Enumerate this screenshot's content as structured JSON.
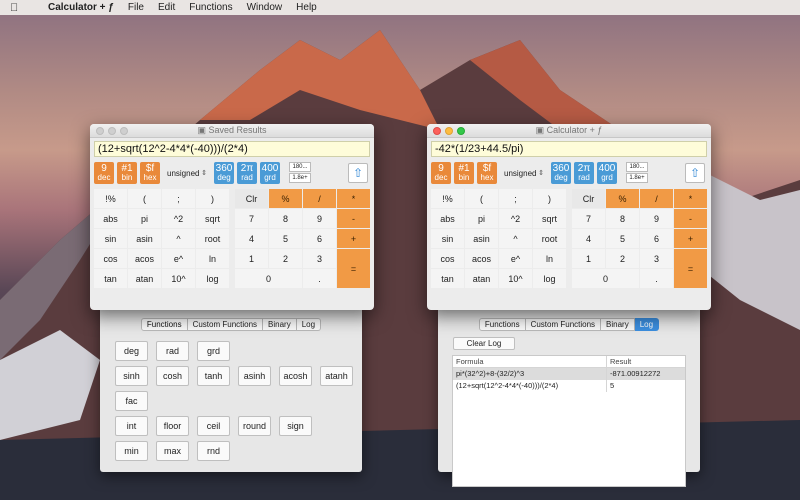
{
  "menubar": {
    "app": "Calculator + ƒ",
    "items": [
      "File",
      "Edit",
      "Functions",
      "Window",
      "Help"
    ]
  },
  "left": {
    "title": "Saved Results",
    "expression": "(12+sqrt(12^2-4*4*(-40)))/(2*4)"
  },
  "right": {
    "title": "Calculator + ƒ",
    "expression": "-42*(1/23+44.5/pi)"
  },
  "modes": {
    "base": [
      {
        "top": "9",
        "sub": "dec"
      },
      {
        "top": "#1",
        "sub": "bin"
      },
      {
        "top": "$f",
        "sub": "hex"
      }
    ],
    "signed": "unsigned",
    "angle": [
      {
        "top": "360",
        "sub": "deg"
      },
      {
        "top": "2π",
        "sub": "rad"
      },
      {
        "top": "400",
        "sub": "grd"
      }
    ],
    "sci": [
      "180...",
      "1.8e+"
    ]
  },
  "keys": {
    "func": [
      "!%",
      "(",
      ";",
      ")",
      "abs",
      "pi",
      "^2",
      "sqrt",
      "sin",
      "asin",
      "^",
      "root",
      "cos",
      "acos",
      "e^",
      "ln",
      "tan",
      "atan",
      "10^",
      "log"
    ],
    "clr": "Clr",
    "pct": "%",
    "div": "/",
    "mul": "*",
    "sub": "-",
    "add": "+",
    "eq": "=",
    "digits": [
      "7",
      "8",
      "9",
      "4",
      "5",
      "6",
      "1",
      "2",
      "3"
    ],
    "zero": "0",
    "dot": "."
  },
  "lpanel": {
    "tabs": [
      "Functions",
      "Custom Functions",
      "Binary",
      "Log"
    ],
    "rows": [
      [
        "deg",
        "rad",
        "grd"
      ],
      [
        "sinh",
        "cosh",
        "tanh",
        "asinh",
        "acosh",
        "atanh"
      ],
      [
        "fac"
      ],
      [
        "int",
        "floor",
        "ceil",
        "round",
        "sign"
      ],
      [
        "min",
        "max",
        "rnd"
      ]
    ]
  },
  "rpanel": {
    "tabs": [
      "Functions",
      "Custom Functions",
      "Binary",
      "Log"
    ],
    "clear": "Clear Log",
    "cols": [
      "Formula",
      "Result"
    ],
    "rows": [
      {
        "f": "pi*(32^2)+8-(32/2)^3",
        "r": "-871.00912272"
      },
      {
        "f": "(12+sqrt(12^2-4*4*(-40)))/(2*4)",
        "r": "5"
      }
    ]
  }
}
